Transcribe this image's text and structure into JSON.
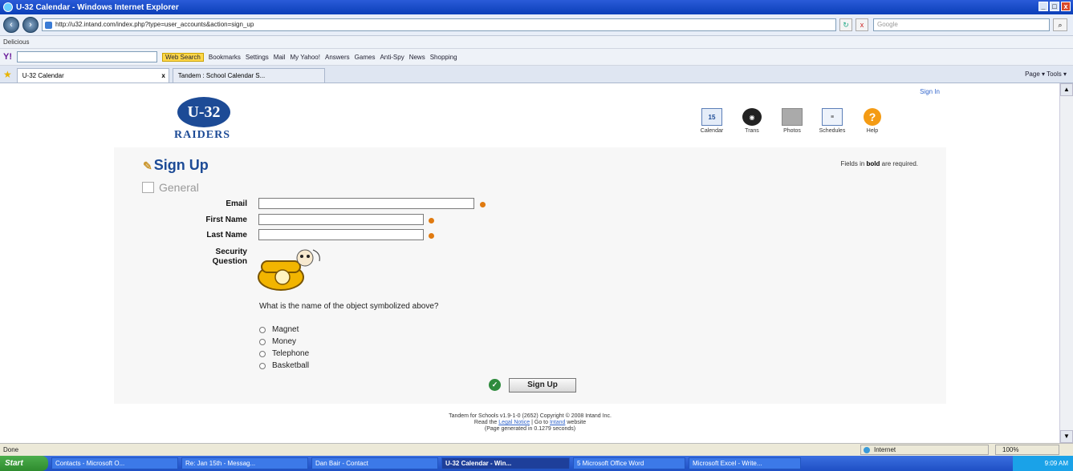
{
  "window": {
    "title": "U-32 Calendar - Windows Internet Explorer"
  },
  "browser": {
    "address": "http://u32.intand.com/index.php?type=user_accounts&action=sign_up",
    "search_placeholder": "Google",
    "delicious_label": "Delicious",
    "yahoo_items": [
      "Web Search",
      "Bookmarks",
      "Settings",
      "Mail",
      "My Yahoo!",
      "Answers",
      "Games",
      "Anti-Spy",
      "News",
      "Shopping"
    ],
    "tabs": [
      {
        "label": "U-32 Calendar"
      },
      {
        "label": "Tandem : School Calendar S..."
      }
    ],
    "command_bar": "Page ▾  Tools ▾"
  },
  "site": {
    "sign_in": "Sign In",
    "logo_top": "U-32",
    "logo_bottom": "RAIDERS",
    "nav": [
      {
        "label": "Calendar",
        "icon": "calendar-icon"
      },
      {
        "label": "Trans",
        "icon": "bus-icon"
      },
      {
        "label": "Photos",
        "icon": "photos-icon"
      },
      {
        "label": "Schedules",
        "icon": "schedules-icon"
      },
      {
        "label": "Help",
        "icon": "help-icon"
      }
    ]
  },
  "form": {
    "title": "Sign Up",
    "required_prefix": "Fields in ",
    "required_bold": "bold",
    "required_suffix": " are required.",
    "section": "General",
    "fields": [
      {
        "label": "Email",
        "value": ""
      },
      {
        "label": "First Name",
        "value": ""
      },
      {
        "label": "Last Name",
        "value": ""
      }
    ],
    "security_label_1": "Security",
    "security_label_2": "Question",
    "question": "What is the name of the object symbolized above?",
    "options": [
      "Magnet",
      "Money",
      "Telephone",
      "Basketball"
    ],
    "submit": "Sign Up"
  },
  "footer": {
    "line1": "Tandem for Schools v1.9-1-0 (2652) Copyright © 2008 Intand Inc.",
    "line2_a": "Read the ",
    "legal": "Legal Notice",
    "line2_b": "  |  Go to ",
    "intand": "Intand",
    "line2_c": " website",
    "line3": "(Page generated in 0.1279 seconds)"
  },
  "status": {
    "text": "Done",
    "zone": "Internet",
    "zoom": "100%"
  },
  "taskbar": {
    "start": "Start",
    "tasks": [
      "Contacts - Microsoft O...",
      "Re: Jan 15th - Messag...",
      "Dan Bair - Contact",
      "U-32 Calendar - Win...",
      "5 Microsoft Office Word",
      "Microsoft Excel - Write..."
    ],
    "time": "9:09 AM"
  }
}
